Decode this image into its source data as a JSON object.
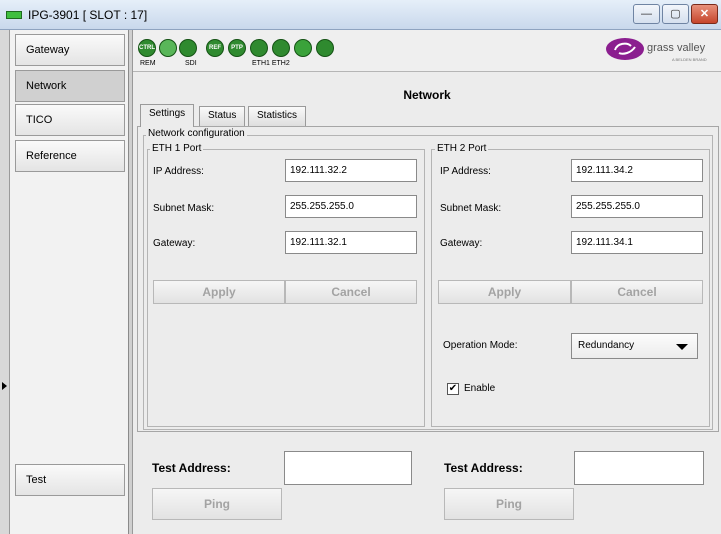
{
  "window": {
    "title": "IPG-3901 [ SLOT : 17]",
    "min_label": "—",
    "max_label": "▢",
    "close_label": "✕"
  },
  "sidebar": {
    "items": [
      {
        "label": "Gateway"
      },
      {
        "label": "Network"
      },
      {
        "label": "TICO"
      },
      {
        "label": "Reference"
      },
      {
        "label": "Test"
      }
    ]
  },
  "status_icons": {
    "ctrl": "CTRL",
    "ref": "REF",
    "ptp": "PTP",
    "rem_label": "REM",
    "sdi_label": "SDI",
    "eth_label": "ETH1 ETH2"
  },
  "brand": {
    "name": "grass valley",
    "sub": "A BELDEN BRAND",
    "logo_color": "#8b1e8f"
  },
  "page": {
    "title": "Network",
    "tabs": [
      {
        "label": "Settings"
      },
      {
        "label": "Status"
      },
      {
        "label": "Statistics"
      }
    ],
    "group_title": "Network configuration"
  },
  "eth1": {
    "title": "ETH 1 Port",
    "ip_label": "IP Address:",
    "ip_value": "192.111.32.2",
    "mask_label": "Subnet Mask:",
    "mask_value": "255.255.255.0",
    "gw_label": "Gateway:",
    "gw_value": "192.111.32.1",
    "apply": "Apply",
    "cancel": "Cancel"
  },
  "eth2": {
    "title": "ETH 2 Port",
    "ip_label": "IP Address:",
    "ip_value": "192.111.34.2",
    "mask_label": "Subnet Mask:",
    "mask_value": "255.255.255.0",
    "gw_label": "Gateway:",
    "gw_value": "192.111.34.1",
    "apply": "Apply",
    "cancel": "Cancel",
    "mode_label": "Operation Mode:",
    "mode_value": "Redundancy",
    "enable_label": "Enable",
    "enable_checked": true
  },
  "test": {
    "addr1_label": "Test Address:",
    "addr1_value": "",
    "ping1": "Ping",
    "addr2_label": "Test Address:",
    "addr2_value": "",
    "ping2": "Ping"
  }
}
